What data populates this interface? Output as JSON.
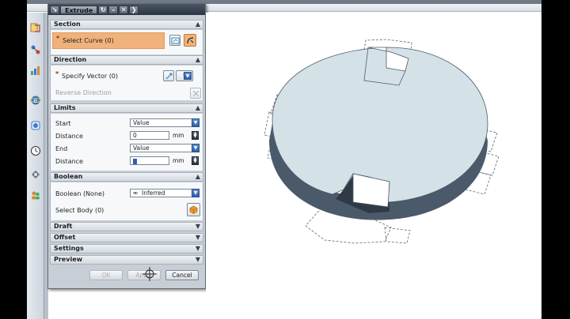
{
  "dialog": {
    "title": "Extrude",
    "title_buttons": [
      "↻",
      "–",
      "✕",
      "❯"
    ],
    "sections": {
      "section": {
        "label": "Section",
        "select_curve": "Select Curve (0)"
      },
      "direction": {
        "label": "Direction",
        "specify_vector": "Specify Vector (0)",
        "reverse_direction": "Reverse Direction"
      },
      "limits": {
        "label": "Limits",
        "start_label": "Start",
        "start_value": "Value",
        "distance1_label": "Distance",
        "distance1_value": "0",
        "end_label": "End",
        "end_value": "Value",
        "distance2_label": "Distance",
        "distance2_value": "",
        "unit": "mm"
      },
      "boolean": {
        "label": "Boolean",
        "boolean_label": "Boolean (None)",
        "boolean_value": "Inferred",
        "select_body": "Select Body (0)"
      },
      "draft": {
        "label": "Draft"
      },
      "offset": {
        "label": "Offset"
      },
      "settings": {
        "label": "Settings"
      },
      "preview": {
        "label": "Preview"
      }
    },
    "buttons": {
      "ok": "OK",
      "apply": "Apply",
      "cancel": "Cancel"
    }
  },
  "colors": {
    "accent": "#f0b27a",
    "disk_face": "#d4e2e8",
    "disk_edge": "#4b5a6a",
    "dialog_bg": "#c7ced6"
  },
  "icons": [
    "sketch-icon",
    "curve-icon",
    "vector-icon",
    "body-icon",
    "cube-icon"
  ]
}
